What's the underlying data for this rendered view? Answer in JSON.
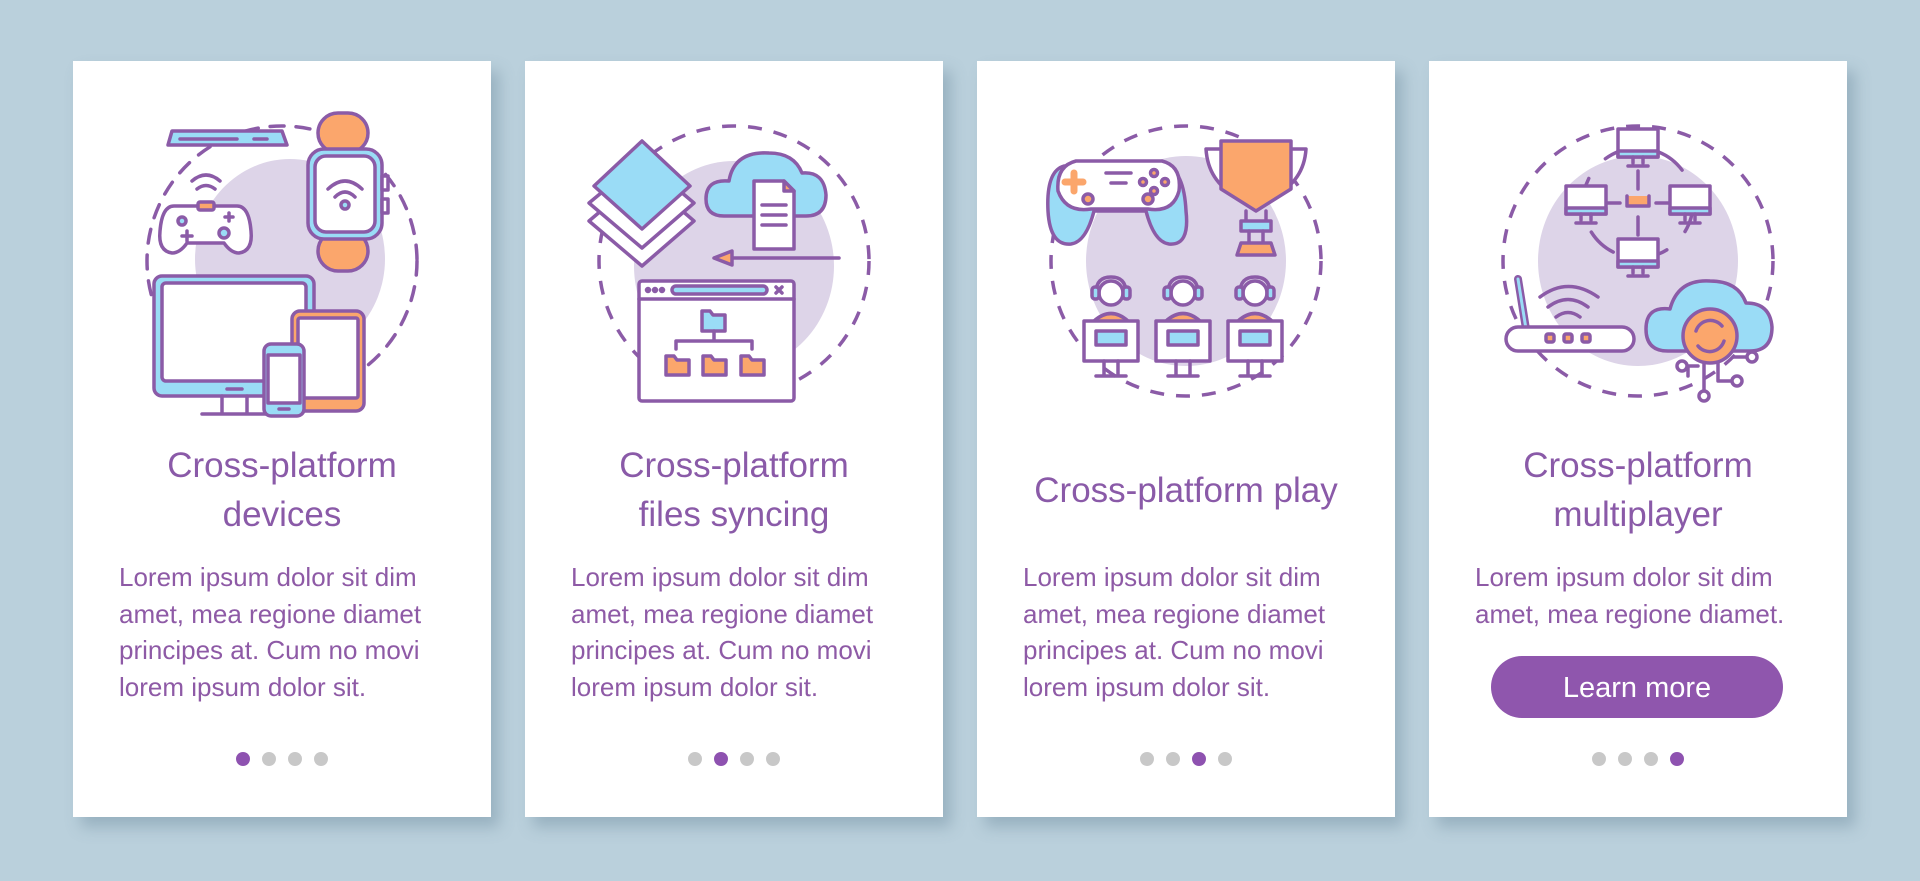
{
  "colors": {
    "background": "#bad0dc",
    "card": "#ffffff",
    "accent": "#8f56ad",
    "text": "#8a5aa8",
    "dot_inactive": "#c8c8c8",
    "icon_outline": "#8b5ba7",
    "icon_blue": "#9adcf6",
    "icon_orange": "#fba66c",
    "icon_circle_bg": "#ddd4e8"
  },
  "screens": [
    {
      "title_lines": [
        "Cross-platform",
        "devices"
      ],
      "body_lines": [
        "Lorem ipsum dolor sit dim",
        "amet, mea regione diamet",
        "principes at. Cum no movi",
        "lorem ipsum dolor sit."
      ],
      "illustration": "cross-platform-devices-illustration",
      "page_index": 1,
      "page_count": 4
    },
    {
      "title_lines": [
        "Cross-platform",
        "files syncing"
      ],
      "body_lines": [
        "Lorem ipsum dolor sit dim",
        "amet, mea regione diamet",
        "principes at. Cum no movi",
        "lorem ipsum dolor sit."
      ],
      "illustration": "files-syncing-illustration",
      "page_index": 2,
      "page_count": 4
    },
    {
      "title_lines": [
        "Cross-platform play"
      ],
      "body_lines": [
        "Lorem ipsum dolor sit dim",
        "amet, mea regione diamet",
        "principes at. Cum no movi",
        "lorem ipsum dolor sit."
      ],
      "illustration": "cross-platform-play-illustration",
      "page_index": 3,
      "page_count": 4
    },
    {
      "title_lines": [
        "Cross-platform",
        "multiplayer"
      ],
      "body_lines": [
        "Lorem ipsum dolor sit dim",
        "amet, mea regione diamet."
      ],
      "button_label": "Learn more",
      "illustration": "multiplayer-network-illustration",
      "page_index": 4,
      "page_count": 4
    }
  ]
}
